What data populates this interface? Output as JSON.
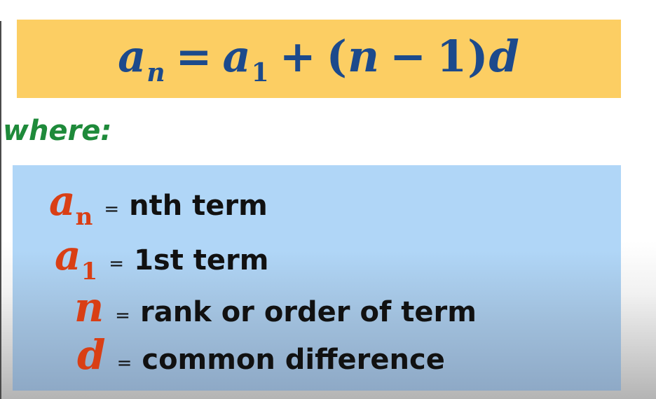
{
  "formula": {
    "lhs_var": "a",
    "lhs_sub": "n",
    "eq": "=",
    "a_var": "a",
    "a_sub": "1",
    "plus": "+",
    "open_paren": "(",
    "n_var": "n",
    "minus": "−",
    "one": "1",
    "close_paren": ")",
    "d_var": "d"
  },
  "where_label": "where:",
  "definitions": [
    {
      "var": "a",
      "sub": "n",
      "eq": "=",
      "text": "nth term"
    },
    {
      "var": "a",
      "sub": "1",
      "eq": "=",
      "text": "1st term"
    },
    {
      "var": "n",
      "sub": "",
      "eq": "=",
      "text": "rank or order of term"
    },
    {
      "var": "d",
      "sub": "",
      "eq": "=",
      "text": "common difference"
    }
  ],
  "colors": {
    "formula_bg": "#fcce63",
    "formula_text": "#1c4a8c",
    "where_text": "#1e8a3a",
    "definitions_bg": "#b0d6f7",
    "symbol_text": "#d93f15"
  }
}
